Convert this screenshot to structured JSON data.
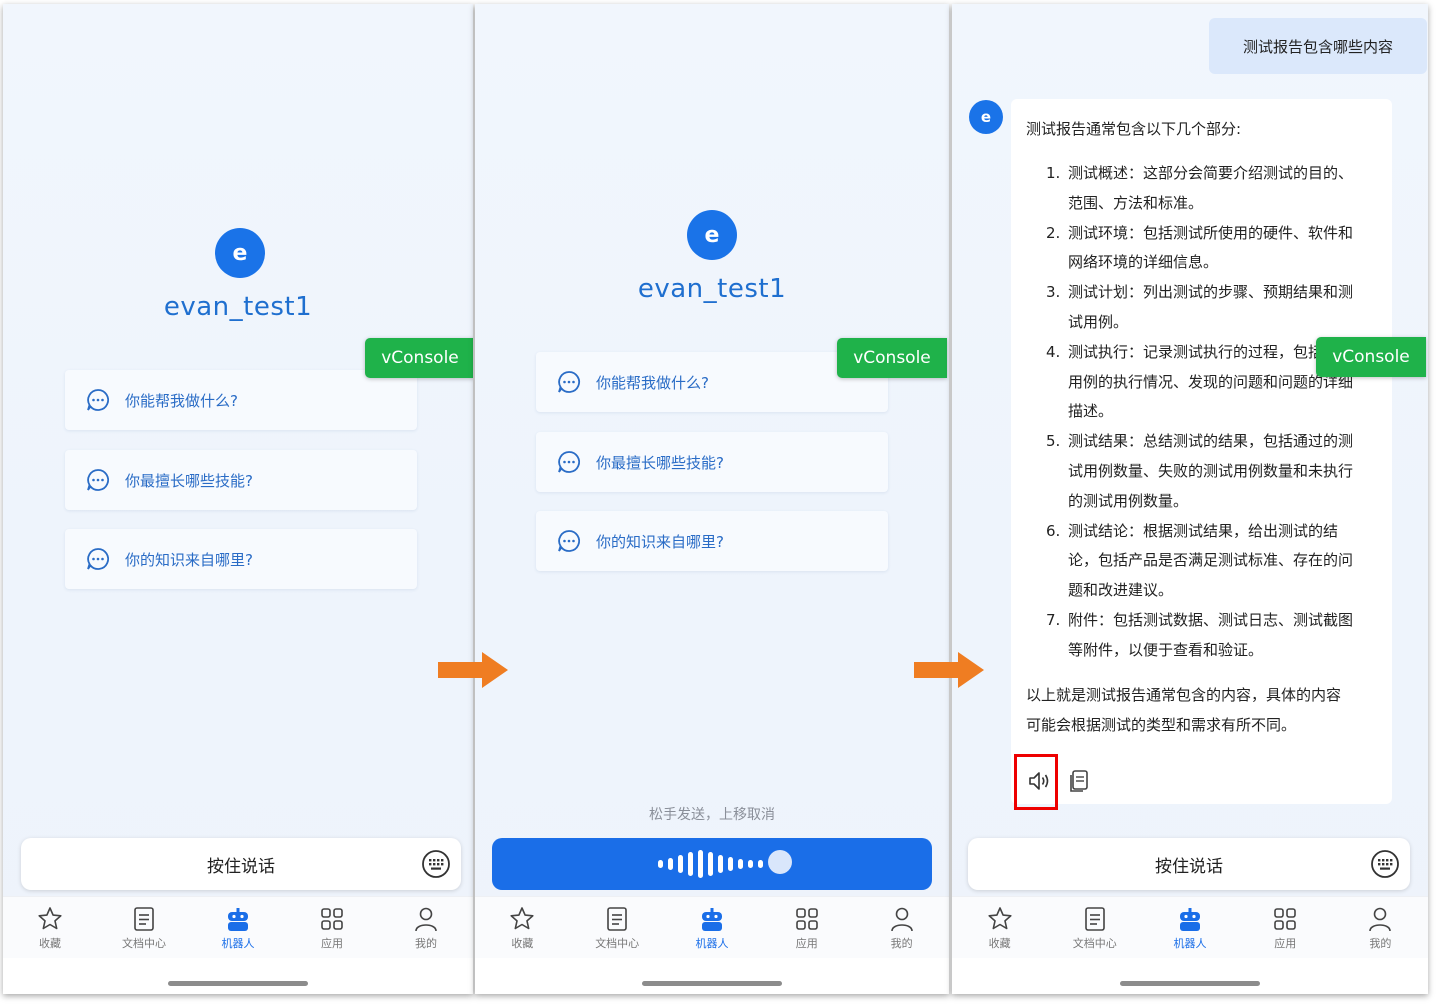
{
  "bot": {
    "avatar_letter": "e",
    "name": "evan_test1"
  },
  "suggestions": [
    "你能帮我做什么?",
    "你最擅长哪些技能?",
    "你的知识来自哪里?"
  ],
  "vconsole_label": "vConsole",
  "talk_button": "按住说话",
  "recording_hint": "松手发送，上移取消",
  "tabs": [
    {
      "label": "收藏",
      "icon": "star-icon"
    },
    {
      "label": "文档中心",
      "icon": "document-icon"
    },
    {
      "label": "机器人",
      "icon": "robot-icon",
      "active": true
    },
    {
      "label": "应用",
      "icon": "apps-grid-icon"
    },
    {
      "label": "我的",
      "icon": "person-icon"
    }
  ],
  "chat": {
    "user_message": "测试报告包含哪些内容",
    "reply_intro": "测试报告通常包含以下几个部分:",
    "reply_items": [
      {
        "num": "1.",
        "lines": [
          "测试概述：这部分会简要介绍测试的目的、",
          "范围、方法和标准。"
        ]
      },
      {
        "num": "2.",
        "lines": [
          "测试环境：包括测试所使用的硬件、软件和",
          "网络环境的详细信息。"
        ]
      },
      {
        "num": "3.",
        "lines": [
          "测试计划：列出测试的步骤、预期结果和测",
          "试用例。"
        ]
      },
      {
        "num": "4.",
        "lines": [
          "测试执行：记录测试执行的过程，包括测试",
          "用例的执行情况、发现的问题和问题的详细",
          "描述。"
        ]
      },
      {
        "num": "5.",
        "lines": [
          "测试结果：总结测试的结果，包括通过的测",
          "试用例数量、失败的测试用例数量和未执行",
          "的测试用例数量。"
        ]
      },
      {
        "num": "6.",
        "lines": [
          "测试结论：根据测试结果，给出测试的结",
          "论，包括产品是否满足测试标准、存在的问",
          "题和改进建议。"
        ]
      },
      {
        "num": "7.",
        "lines": [
          "附件：包括测试数据、测试日志、测试截图",
          "等附件，以便于查看和验证。"
        ]
      }
    ],
    "reply_outro": [
      "以上就是测试报告通常包含的内容，具体的内容",
      "可能会根据测试的类型和需求有所不同。"
    ]
  },
  "colors": {
    "accent": "#1a6ee8",
    "vconsole": "#1fb24a",
    "arrow": "#ef7d22",
    "highlight": "#e00000"
  }
}
